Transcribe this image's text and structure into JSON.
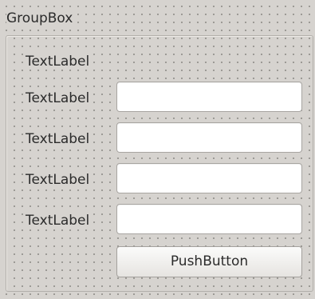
{
  "groupbox": {
    "title": "GroupBox"
  },
  "rows": [
    {
      "label": "TextLabel"
    },
    {
      "label": "TextLabel",
      "field_value": ""
    },
    {
      "label": "TextLabel",
      "field_value": ""
    },
    {
      "label": "TextLabel",
      "field_value": ""
    },
    {
      "label": "TextLabel",
      "field_value": ""
    }
  ],
  "push_button": {
    "label": "PushButton"
  }
}
